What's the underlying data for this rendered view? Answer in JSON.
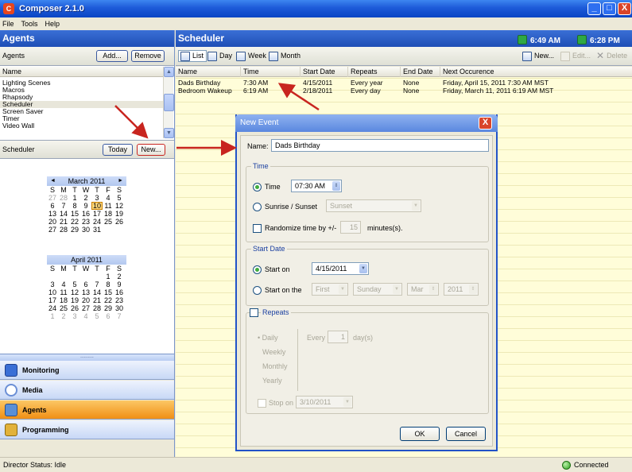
{
  "window": {
    "title": "Composer 2.1.0",
    "minimize": "_",
    "maximize": "□",
    "close": "X"
  },
  "menu": [
    "File",
    "Tools",
    "Help"
  ],
  "agents_panel": {
    "title": "Agents",
    "toolbar_label": "Agents",
    "add_label": "Add...",
    "remove_label": "Remove",
    "column_name": "Name",
    "items": [
      "Lighting Scenes",
      "Macros",
      "Rhapsody",
      "Scheduler",
      "Screen Saver",
      "Timer",
      "Video Wall"
    ],
    "selected_item": "Scheduler"
  },
  "scheduler_bar": {
    "label": "Scheduler",
    "today_label": "Today",
    "new_label": "New..."
  },
  "calendar_march": {
    "title": "March 2011",
    "prev": "◄",
    "next": "►",
    "weekdays": [
      "S",
      "M",
      "T",
      "W",
      "T",
      "F",
      "S"
    ],
    "weeks": [
      [
        "27",
        "28",
        "1",
        "2",
        "3",
        "4",
        "5"
      ],
      [
        "6",
        "7",
        "8",
        "9",
        "10",
        "11",
        "12"
      ],
      [
        "13",
        "14",
        "15",
        "16",
        "17",
        "18",
        "19"
      ],
      [
        "20",
        "21",
        "22",
        "23",
        "24",
        "25",
        "26"
      ],
      [
        "27",
        "28",
        "29",
        "30",
        "31",
        "",
        ""
      ]
    ],
    "today": "10"
  },
  "calendar_april": {
    "title": "April 2011",
    "weekdays": [
      "S",
      "M",
      "T",
      "W",
      "T",
      "F",
      "S"
    ],
    "weeks": [
      [
        "",
        "",
        "",
        "",
        "",
        "1",
        "2"
      ],
      [
        "3",
        "4",
        "5",
        "6",
        "7",
        "8",
        "9"
      ],
      [
        "10",
        "11",
        "12",
        "13",
        "14",
        "15",
        "16"
      ],
      [
        "17",
        "18",
        "19",
        "20",
        "21",
        "22",
        "23"
      ],
      [
        "24",
        "25",
        "26",
        "27",
        "28",
        "29",
        "30"
      ],
      [
        "1",
        "2",
        "3",
        "4",
        "5",
        "6",
        "7"
      ]
    ]
  },
  "nav": {
    "grip": "..........",
    "monitoring": "Monitoring",
    "media": "Media",
    "agents": "Agents",
    "programming": "Programming",
    "active": "Agents"
  },
  "scheduler": {
    "title": "Scheduler",
    "clock1": "6:49 AM",
    "clock2": "6:28 PM",
    "views": {
      "list": "List",
      "day": "Day",
      "week": "Week",
      "month": "Month"
    },
    "new_label": "New...",
    "edit_label": "Edit...",
    "delete_label": "Delete",
    "columns": [
      "Name",
      "Time",
      "Start Date",
      "Repeats",
      "End Date",
      "Next Occurence"
    ],
    "rows": [
      {
        "name": "Dads Birthday",
        "time": "7:30 AM",
        "start": "4/15/2011",
        "repeats": "Every year",
        "end": "None",
        "next": "Friday, April 15, 2011 7:30 AM MST"
      },
      {
        "name": "Bedroom Wakeup",
        "time": "6:19 AM",
        "start": "2/18/2011",
        "repeats": "Every day",
        "end": "None",
        "next": "Friday, March 11, 2011 6:19 AM MST"
      }
    ]
  },
  "dialog": {
    "title": "New Event",
    "close": "X",
    "name_label": "Name:",
    "name_value": "Dads Birthday",
    "time_group": "Time",
    "time_radio": "Time",
    "time_value": "07:30 AM",
    "sunrise_radio": "Sunrise / Sunset",
    "sunrise_value": "Sunset",
    "randomize_label": "Randomize time by +/-",
    "randomize_value": "15",
    "minutes_label": "minutes(s).",
    "start_group": "Start Date",
    "start_on_radio": "Start on",
    "start_on_value": "4/15/2011",
    "start_on_the_radio": "Start on the",
    "first_value": "First",
    "sunday_value": "Sunday",
    "month_value": "Mar",
    "year_value": "2011",
    "repeats_label": "Repeats",
    "repeat_options": [
      "Daily",
      "Weekly",
      "Monthly",
      "Yearly"
    ],
    "every_label": "Every",
    "every_value": "1",
    "days_label": "day(s)",
    "stop_on_label": "Stop on",
    "stop_on_value": "3/10/2011",
    "ok_label": "OK",
    "cancel_label": "Cancel"
  },
  "status": {
    "text": "Director Status: Idle",
    "connection": "Connected"
  },
  "colors": {
    "accent_blue": "#1f4fb6",
    "active_nav": "#f08f15",
    "annotation_arrow": "#c8251f",
    "grid_yellow": "#fffdd9"
  }
}
